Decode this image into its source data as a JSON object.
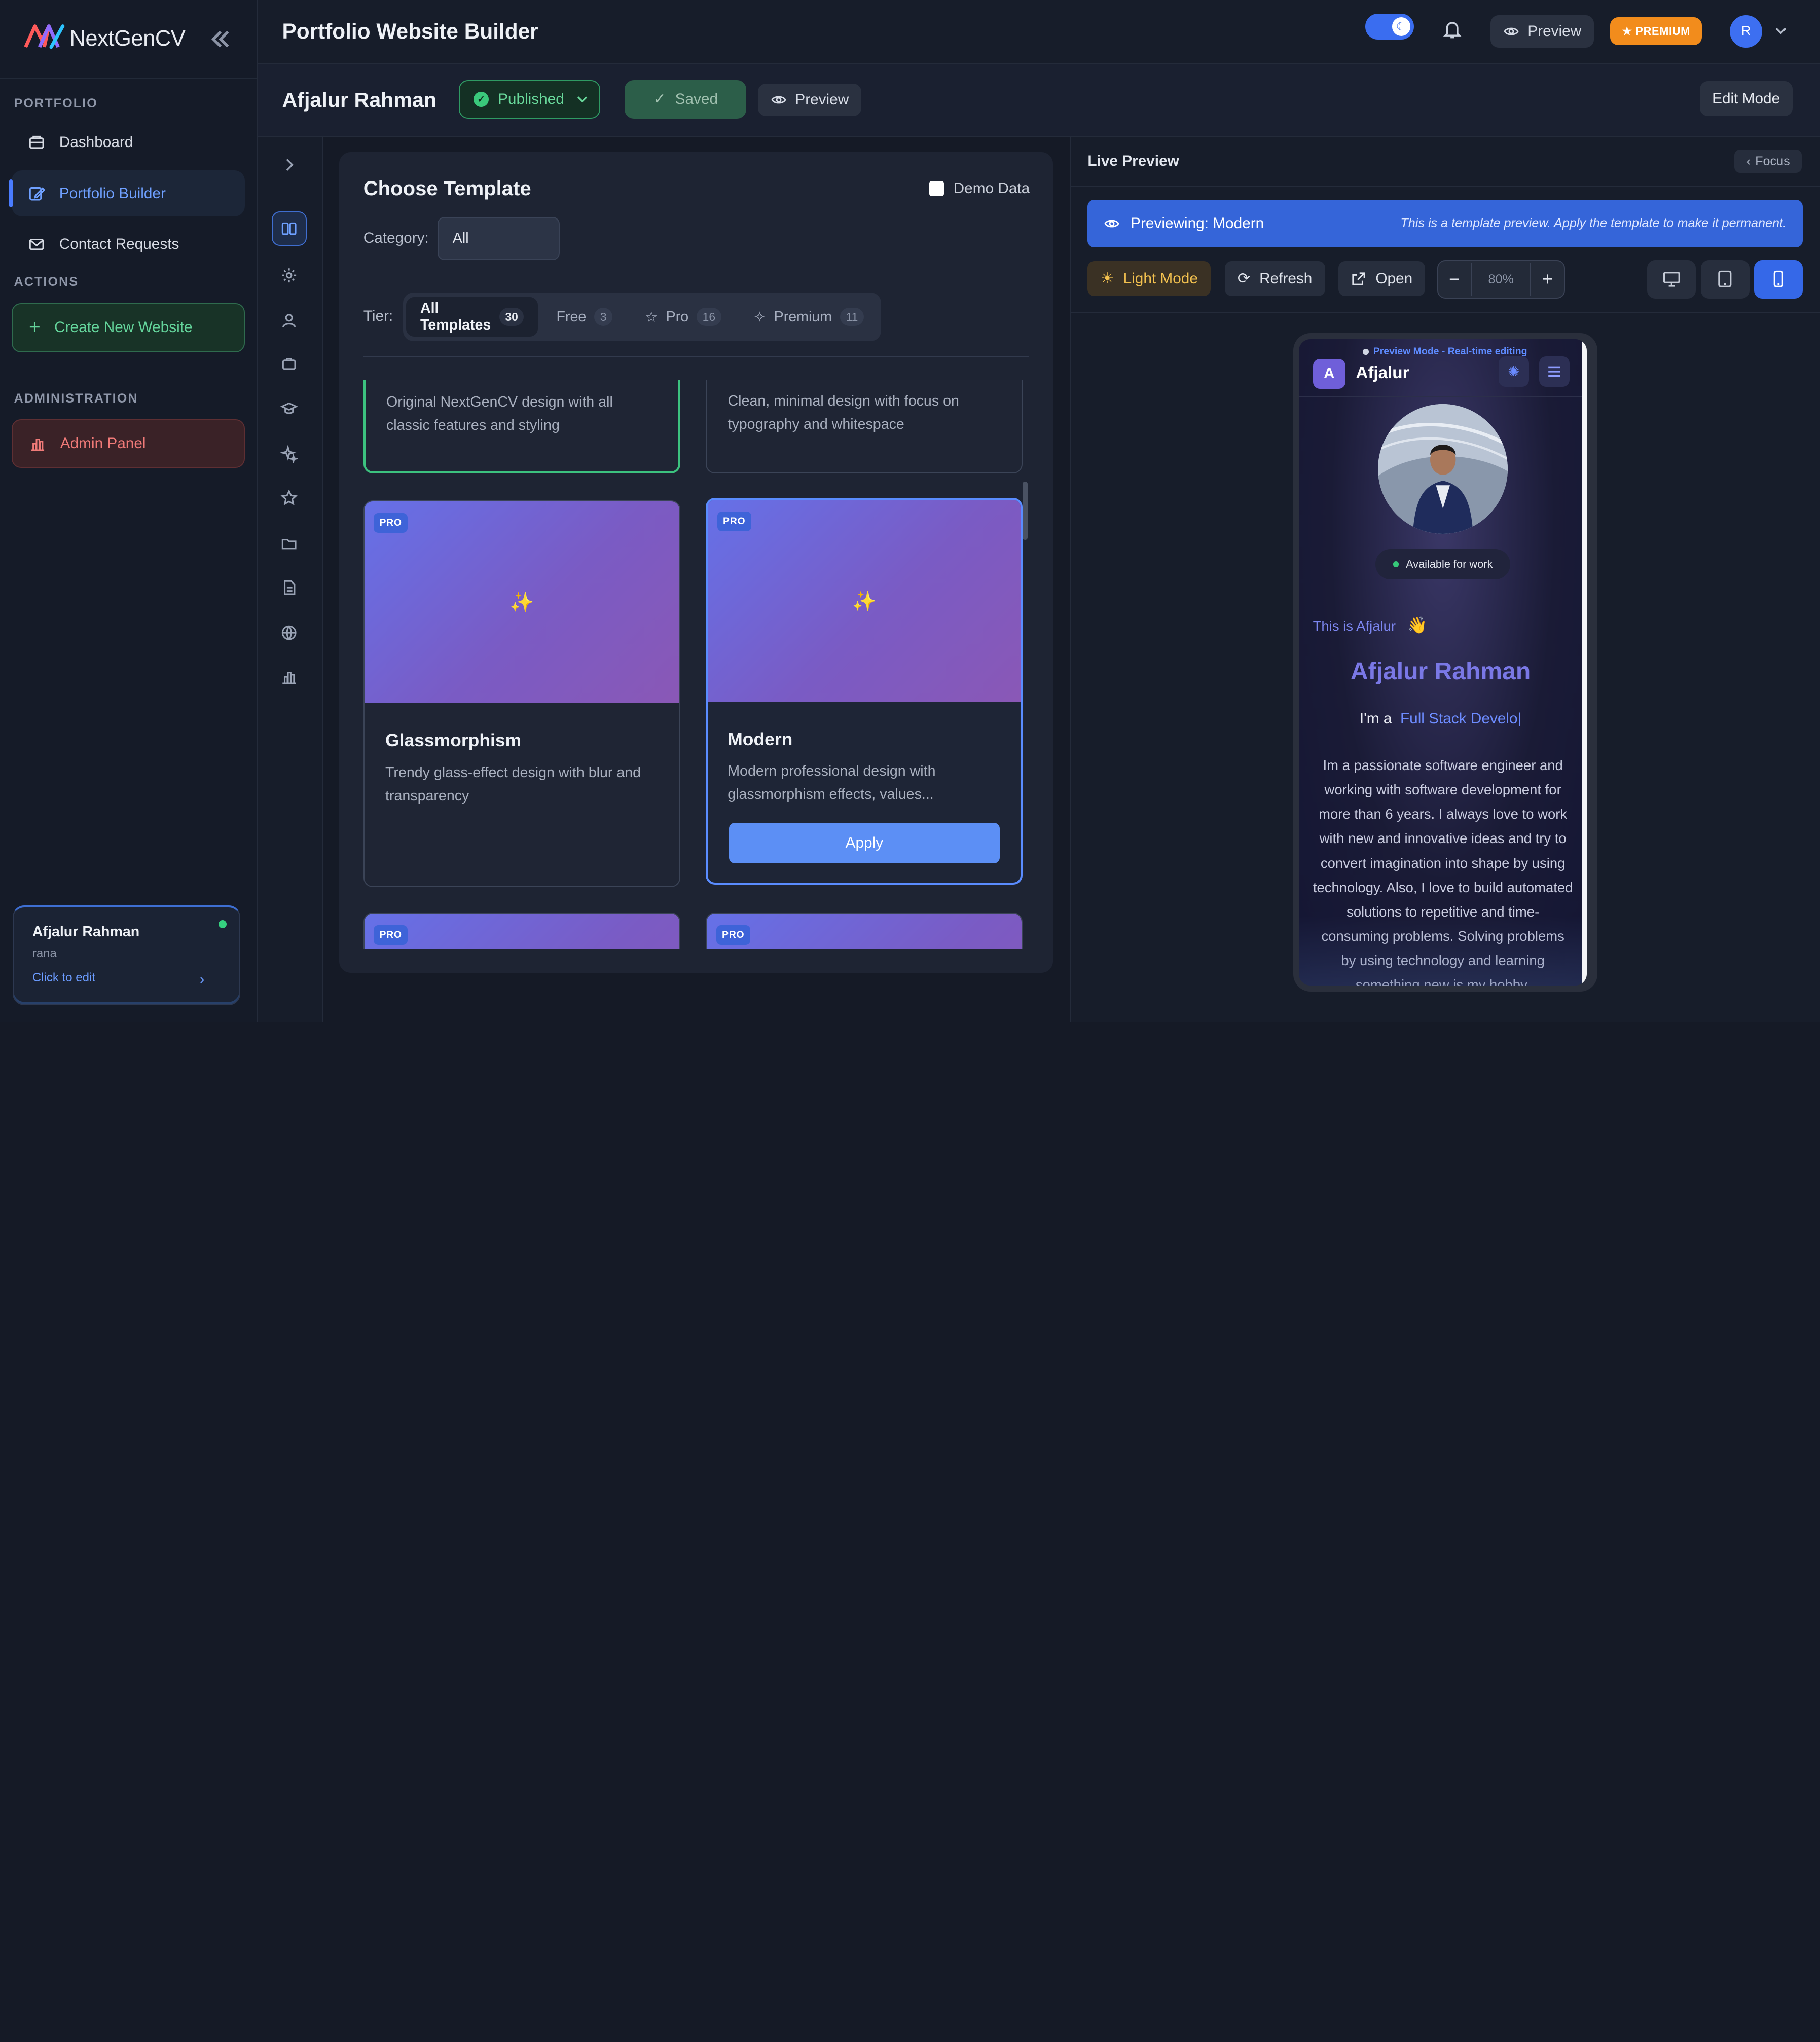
{
  "brand": {
    "name": "NextGenCV"
  },
  "sidebar": {
    "portfolio_title": "PORTFOLIO",
    "items": [
      {
        "label": "Dashboard"
      },
      {
        "label": "Portfolio Builder"
      },
      {
        "label": "Contact Requests"
      }
    ],
    "actions_title": "ACTIONS",
    "create_label": "Create New Website",
    "admin_title": "ADMINISTRATION",
    "admin_label": "Admin Panel",
    "user": {
      "name": "Afjalur Rahman",
      "handle": "rana",
      "edit": "Click to edit"
    }
  },
  "topbar": {
    "title": "Portfolio Website Builder",
    "preview_label": "Preview",
    "premium_label": "PREMIUM",
    "avatar_initial": "R"
  },
  "subbar": {
    "owner": "Afjalur Rahman",
    "status": "Published",
    "saved": "Saved",
    "preview": "Preview",
    "edit_mode": "Edit Mode"
  },
  "templates": {
    "title": "Choose Template",
    "demo_label": "Demo Data",
    "category_label": "Category:",
    "category_value": "All",
    "tier_label": "Tier:",
    "tiers": [
      {
        "label": "All Templates",
        "count": "30"
      },
      {
        "label": "Free",
        "count": "3"
      },
      {
        "label": "Pro",
        "count": "16"
      },
      {
        "label": "Premium",
        "count": "11"
      }
    ],
    "cards": [
      {
        "desc": "Original NextGenCV design with all classic features and styling"
      },
      {
        "desc": "Clean, minimal design with focus on typography and whitespace"
      },
      {
        "badge": "PRO",
        "title": "Glassmorphism",
        "desc": "Trendy glass-effect design with blur and transparency"
      },
      {
        "badge": "PRO",
        "title": "Modern",
        "desc": "Modern professional design with glassmorphism effects, values...",
        "apply": "Apply"
      },
      {
        "badge": "PRO"
      },
      {
        "badge": "PRO"
      }
    ]
  },
  "live_preview": {
    "title": "Live Preview",
    "focus_label": "Focus",
    "banner_title": "Previewing: Modern",
    "banner_note": "This is a template preview. Apply the template to make it permanent.",
    "light_mode": "Light Mode",
    "refresh": "Refresh",
    "open": "Open",
    "zoom": "80%"
  },
  "phone": {
    "mode_label": "Preview Mode - Real-time editing",
    "logo_initial": "A",
    "site_name": "Afjalur",
    "available": "Available for work",
    "greeting": "This is Afjalur",
    "greeting_emoji": "👋",
    "full_name": "Afjalur Rahman",
    "role_prefix": "I'm a",
    "role": "Full Stack Develo|",
    "bio": "Im a passionate software engineer and working with software development for more than 6 years. I always love to work with new and innovative ideas and try to convert imagination into shape by using technology. Also, I love to build automated solutions to repetitive and time-consuming problems. Solving problems by using technology and learning something new is my hobby."
  },
  "colors": {
    "accent": "#3568e8",
    "success": "#35d07f",
    "danger": "#f07a78",
    "premium": "#f28c1c"
  }
}
